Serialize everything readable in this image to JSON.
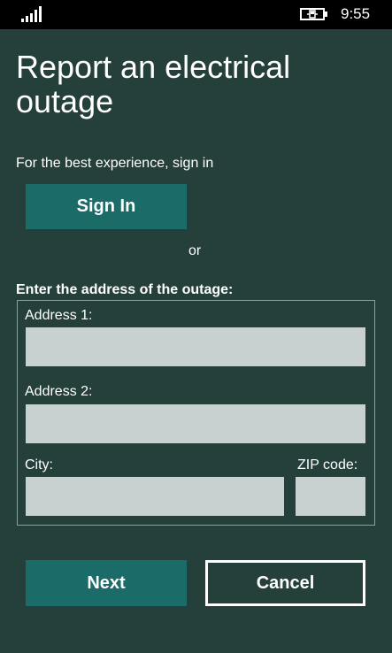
{
  "status_bar": {
    "time": "9:55",
    "icons": [
      "signal-icon",
      "battery-charging-icon"
    ]
  },
  "page": {
    "title": "Report an electrical outage",
    "subtitle": "For the best experience, sign in",
    "sign_in_label": "Sign In",
    "or_label": "or",
    "address_section_label": "Enter the address of the outage:"
  },
  "form": {
    "address1": {
      "label": "Address 1:",
      "value": "",
      "placeholder": ""
    },
    "address2": {
      "label": "Address 2:",
      "value": "",
      "placeholder": ""
    },
    "city": {
      "label": "City:",
      "value": "",
      "placeholder": ""
    },
    "zip": {
      "label": "ZIP code:",
      "value": "",
      "placeholder": ""
    }
  },
  "actions": {
    "next_label": "Next",
    "cancel_label": "Cancel"
  },
  "colors": {
    "background": "#25403a",
    "accent": "#1b6b69",
    "field": "#c9d1d0",
    "status_bar": "#000000"
  }
}
